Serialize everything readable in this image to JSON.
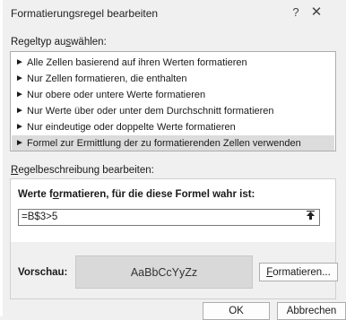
{
  "window": {
    "title": "Formatierungsregel bearbeiten",
    "help_label": "?",
    "close_label": "✕",
    "left_fragment": "("
  },
  "rule_type": {
    "label_before": "Regeltyp au",
    "label_accel": "s",
    "label_after": "wählen:",
    "arrow_glyph": "►",
    "items": [
      {
        "label": "Alle Zellen basierend auf ihren Werten formatieren",
        "selected": false
      },
      {
        "label": "Nur Zellen formatieren, die enthalten",
        "selected": false
      },
      {
        "label": "Nur obere oder untere Werte formatieren",
        "selected": false
      },
      {
        "label": "Nur Werte über oder unter dem Durchschnitt formatieren",
        "selected": false
      },
      {
        "label": "Nur eindeutige oder doppelte Werte formatieren",
        "selected": false
      },
      {
        "label": "Formel zur Ermittlung der zu formatierenden Zellen verwenden",
        "selected": true
      }
    ]
  },
  "description": {
    "label_accel": "R",
    "label_after": "egelbeschreibung bearbeiten:",
    "heading_before": "Werte f",
    "heading_accel": "o",
    "heading_after": "rmatieren, für die diese Formel wahr ist:",
    "formula_value": "=B$3>5",
    "ref_button_icon": "collapse-dialog-icon",
    "preview_label": "Vorschau:",
    "preview_sample": "AaBbCcYyZz",
    "format_button_accel": "F",
    "format_button_after": "ormatieren..."
  },
  "footer": {
    "ok_label": "OK",
    "cancel_label": "Abbrechen"
  },
  "colors": {
    "dialog_bg": "#f0f0f0",
    "selected_row": "#dcdcdc",
    "preview_bg": "#d9d9d9"
  }
}
